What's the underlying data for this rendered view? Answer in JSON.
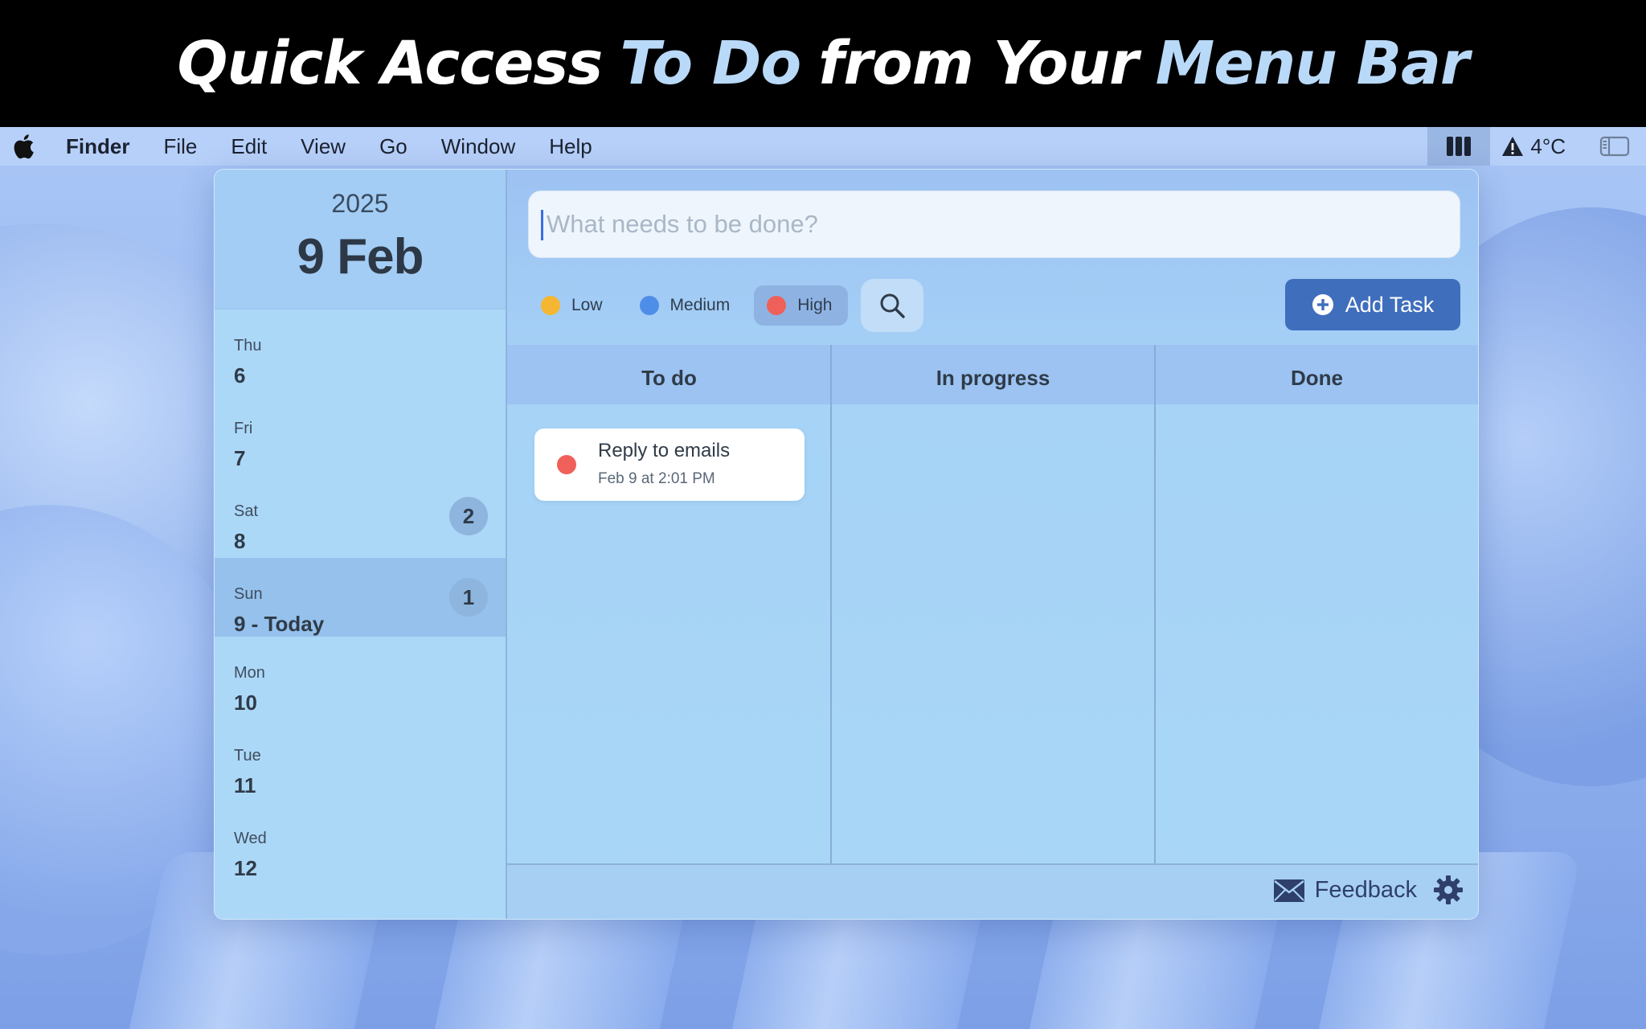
{
  "banner": {
    "part1": "Quick Access",
    "part2": "To Do",
    "part3": "from Your",
    "part4": "Menu Bar"
  },
  "menubar": {
    "apple_icon": "apple-logo-icon",
    "items": [
      "Finder",
      "File",
      "Edit",
      "View",
      "Go",
      "Window",
      "Help"
    ],
    "status": {
      "todo_icon": "columns-icon",
      "weather_icon": "warning-icon",
      "temperature": "4°C",
      "sidebar_icon": "sidebar-toggle-icon"
    }
  },
  "calendar": {
    "year": "2025",
    "date": "9 Feb",
    "days": [
      {
        "dow": "Thu",
        "num": "6",
        "badge": ""
      },
      {
        "dow": "Fri",
        "num": "7",
        "badge": ""
      },
      {
        "dow": "Sat",
        "num": "8",
        "badge": "2"
      },
      {
        "dow": "Sun",
        "num": "9 - Today",
        "badge": "1"
      },
      {
        "dow": "Mon",
        "num": "10",
        "badge": ""
      },
      {
        "dow": "Tue",
        "num": "11",
        "badge": ""
      },
      {
        "dow": "Wed",
        "num": "12",
        "badge": ""
      }
    ]
  },
  "task_input": {
    "placeholder": "What needs to be done?",
    "value": ""
  },
  "priority": {
    "low": "Low",
    "medium": "Medium",
    "high": "High",
    "selected": "High",
    "colors": {
      "low": "#f5b731",
      "medium": "#4f8ee8",
      "high": "#f0605a"
    }
  },
  "add_task_label": "Add Task",
  "columns": [
    "To do",
    "In progress",
    "Done"
  ],
  "tasks": [
    {
      "title": "Reply to emails",
      "time": "Feb 9 at 2:01 PM",
      "priority": "High",
      "column": "To do"
    }
  ],
  "footer": {
    "feedback_label": "Feedback",
    "feedback_icon": "envelope-icon",
    "settings_icon": "gear-icon"
  },
  "colors": {
    "accent": "#3f6ebd",
    "banner_highlight": "#b9d9f8"
  }
}
